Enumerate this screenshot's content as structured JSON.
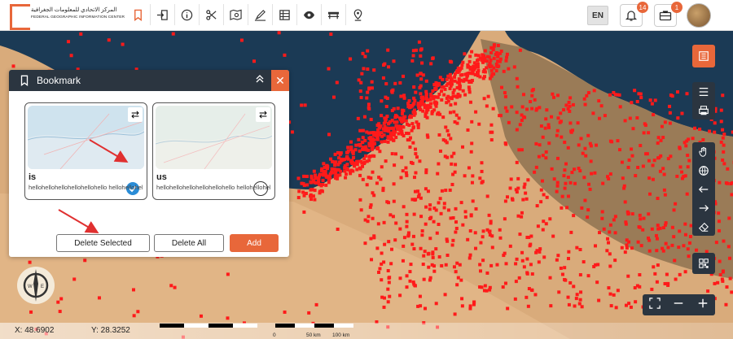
{
  "header": {
    "logo_arabic": "المركز الاتحادي للمعلومات الجغرافية",
    "logo_english": "FEDERAL GEOGRAPHIC INFORMATION CENTER",
    "language": "EN",
    "notifications_count": "14",
    "messages_count": "1",
    "tool_icons": [
      "bookmark-icon",
      "login-icon",
      "info-icon",
      "scissors-icon",
      "map-search-icon",
      "draw-icon",
      "table-icon",
      "eye-icon",
      "bench-icon",
      "location-pin-icon"
    ]
  },
  "bookmark_panel": {
    "title": "Bookmark",
    "cards": [
      {
        "name": "is",
        "description": "hellohellohellohellohellohello hellohellohell...",
        "selected": true
      },
      {
        "name": "us",
        "description": "hellohellohellohellohellohello hellohellohell...",
        "selected": false
      }
    ],
    "buttons": {
      "delete_selected": "Delete Selected",
      "delete_all": "Delete All",
      "add": "Add"
    }
  },
  "status": {
    "x": "X: 48.6902",
    "y": "Y: 28.3252"
  },
  "scale": {
    "labels": [
      "0",
      "50 km",
      "100 km"
    ]
  },
  "colors": {
    "accent": "#e8673a",
    "panel_header": "#2b3540",
    "points": "#ff1a1a"
  }
}
